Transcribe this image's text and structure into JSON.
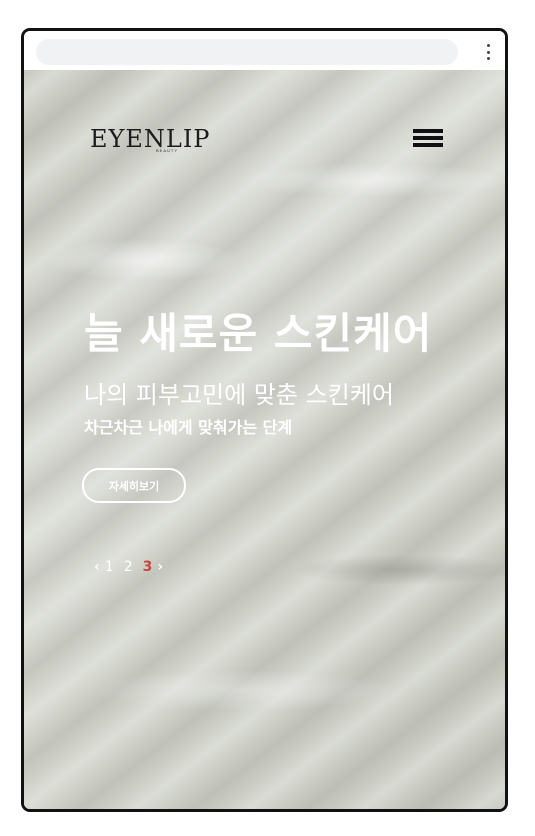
{
  "colors": {
    "overlay_text": "#ffffff",
    "pager_active": "#c6493f",
    "browser_bg": "#ffffff",
    "url_pill_bg": "#f1f2f4"
  },
  "browser": {
    "menu_icon": "kebab-menu-icon"
  },
  "header": {
    "logo_text": "EYENLIP",
    "logo_sub": "BEAUTY",
    "menu_icon": "hamburger-icon"
  },
  "hero": {
    "headline": "늘 새로운 스킨케어",
    "subhead": "나의 피부고민에 맞춘 스킨케어",
    "small_copy": "차근차근 나에게 맞춰가는 단계",
    "cta_label": "자세히보기"
  },
  "pager": {
    "prev": "‹",
    "pages": [
      "1",
      "2",
      "3"
    ],
    "current": "3",
    "next": "›"
  }
}
